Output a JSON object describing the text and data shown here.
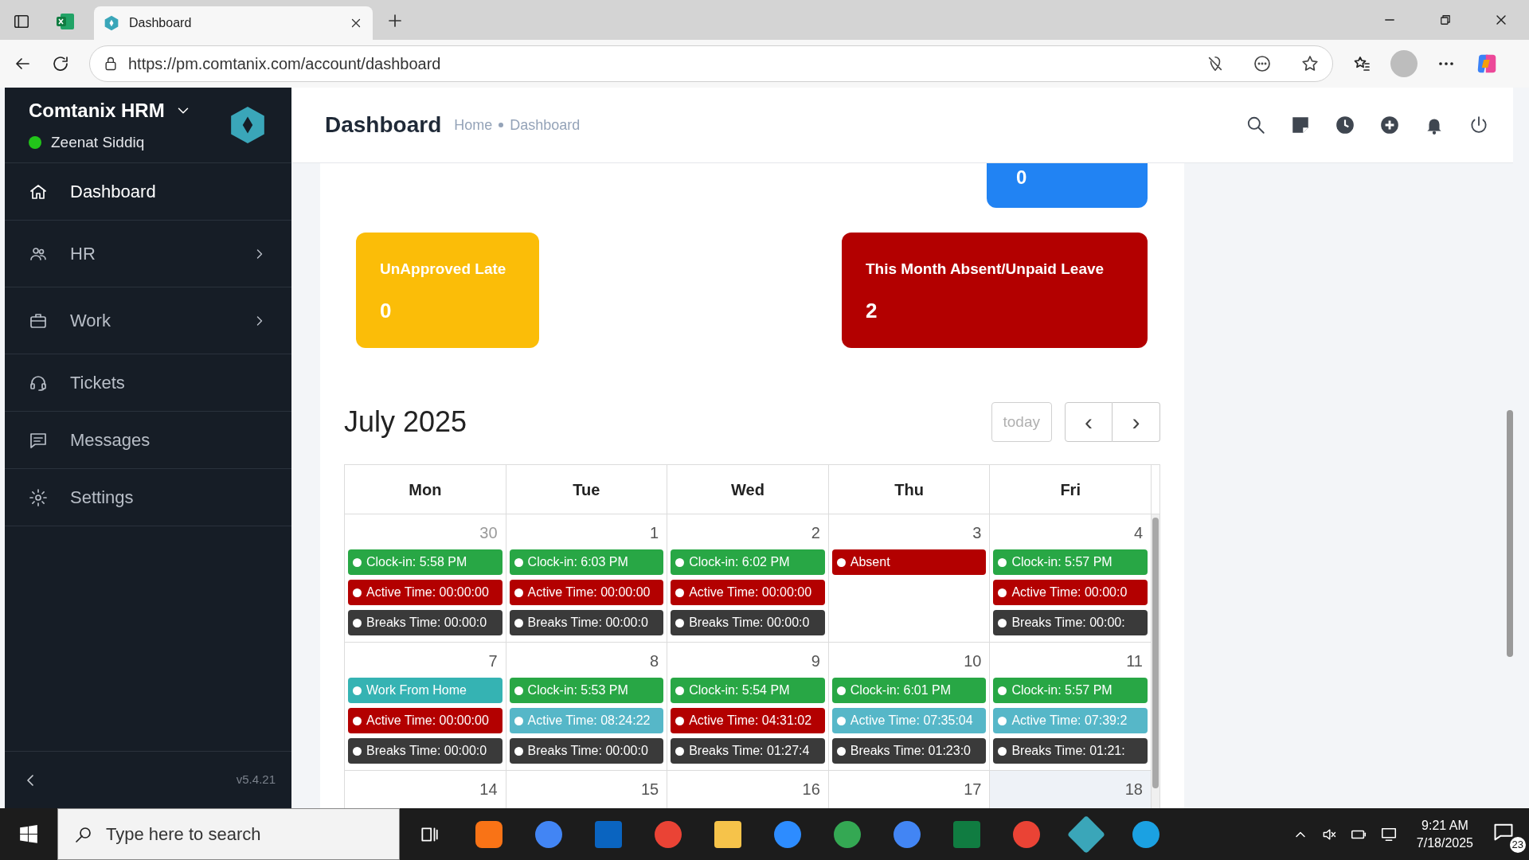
{
  "browser": {
    "tabs": [
      {
        "title": "Dashboard",
        "selected": true
      }
    ],
    "url": "https://pm.comtanix.com/account/dashboard"
  },
  "sidebar": {
    "brand": "Comtanix HRM",
    "user": "Zeenat Siddiq",
    "user_online": true,
    "items": [
      {
        "label": "Dashboard",
        "kind": "home",
        "submenu": false,
        "selected": true
      },
      {
        "label": "HR",
        "kind": "users",
        "submenu": true,
        "selected": false
      },
      {
        "label": "Work",
        "kind": "briefcase",
        "submenu": true,
        "selected": false
      },
      {
        "label": "Tickets",
        "kind": "headset",
        "submenu": false,
        "selected": false
      },
      {
        "label": "Messages",
        "kind": "message",
        "submenu": false,
        "selected": false
      },
      {
        "label": "Settings",
        "kind": "gear",
        "submenu": false,
        "selected": false
      }
    ],
    "version": "v5.4.21"
  },
  "header": {
    "title": "Dashboard",
    "breadcrumb": [
      "Home",
      "Dashboard"
    ]
  },
  "stat_cards": [
    {
      "value": "0",
      "color": "#2183f3",
      "kind": "partial"
    },
    {
      "label": "UnApproved Late",
      "value": "0",
      "color": "#fbbd08",
      "kind": "card"
    },
    {
      "label": "This Month Absent/Unpaid Leave",
      "value": "2",
      "color": "#b30000",
      "kind": "card"
    }
  ],
  "calendar": {
    "title": "July 2025",
    "today_button": "today",
    "prev": "‹",
    "next": "›",
    "columns": [
      "Mon",
      "Tue",
      "Wed",
      "Thu",
      "Fri"
    ],
    "weeks": [
      [
        {
          "day": "30",
          "other_month": true,
          "today": false,
          "events": [
            {
              "text": "Clock-in: 5:58 PM",
              "color": "#28a745"
            },
            {
              "text": "Active Time: 00:00:00",
              "color": "#b30000"
            },
            {
              "text": "Breaks Time: 00:00:0",
              "color": "#3a3a3a"
            }
          ]
        },
        {
          "day": "1",
          "other_month": false,
          "today": false,
          "events": [
            {
              "text": "Clock-in: 6:03 PM",
              "color": "#28a745"
            },
            {
              "text": "Active Time: 00:00:00",
              "color": "#b30000"
            },
            {
              "text": "Breaks Time: 00:00:0",
              "color": "#3a3a3a"
            }
          ]
        },
        {
          "day": "2",
          "other_month": false,
          "today": false,
          "events": [
            {
              "text": "Clock-in: 6:02 PM",
              "color": "#28a745"
            },
            {
              "text": "Active Time: 00:00:00",
              "color": "#b30000"
            },
            {
              "text": "Breaks Time: 00:00:0",
              "color": "#3a3a3a"
            }
          ]
        },
        {
          "day": "3",
          "other_month": false,
          "today": false,
          "events": [
            {
              "text": "Absent",
              "color": "#b30000"
            }
          ]
        },
        {
          "day": "4",
          "other_month": false,
          "today": false,
          "events": [
            {
              "text": "Clock-in: 5:57 PM",
              "color": "#28a745"
            },
            {
              "text": "Active Time: 00:00:0",
              "color": "#b30000"
            },
            {
              "text": "Breaks Time: 00:00:",
              "color": "#3a3a3a"
            }
          ]
        }
      ],
      [
        {
          "day": "7",
          "other_month": false,
          "today": false,
          "events": [
            {
              "text": "Work From Home",
              "color": "#35b3b3"
            },
            {
              "text": "Active Time: 00:00:00",
              "color": "#b30000"
            },
            {
              "text": "Breaks Time: 00:00:0",
              "color": "#3a3a3a"
            }
          ]
        },
        {
          "day": "8",
          "other_month": false,
          "today": false,
          "events": [
            {
              "text": "Clock-in: 5:53 PM",
              "color": "#28a745"
            },
            {
              "text": "Active Time: 08:24:22",
              "color": "#56b7c8"
            },
            {
              "text": "Breaks Time: 00:00:0",
              "color": "#3a3a3a"
            }
          ]
        },
        {
          "day": "9",
          "other_month": false,
          "today": false,
          "events": [
            {
              "text": "Clock-in: 5:54 PM",
              "color": "#28a745"
            },
            {
              "text": "Active Time: 04:31:02",
              "color": "#b30000"
            },
            {
              "text": "Breaks Time: 01:27:4",
              "color": "#3a3a3a"
            }
          ]
        },
        {
          "day": "10",
          "other_month": false,
          "today": false,
          "events": [
            {
              "text": "Clock-in: 6:01 PM",
              "color": "#28a745"
            },
            {
              "text": "Active Time: 07:35:04",
              "color": "#56b7c8"
            },
            {
              "text": "Breaks Time: 01:23:0",
              "color": "#3a3a3a"
            }
          ]
        },
        {
          "day": "11",
          "other_month": false,
          "today": false,
          "events": [
            {
              "text": "Clock-in: 5:57 PM",
              "color": "#28a745"
            },
            {
              "text": "Active Time: 07:39:2",
              "color": "#56b7c8"
            },
            {
              "text": "Breaks Time: 01:21:",
              "color": "#3a3a3a"
            }
          ]
        }
      ],
      [
        {
          "day": "14",
          "other_month": false,
          "today": false
        },
        {
          "day": "15",
          "other_month": false,
          "today": false
        },
        {
          "day": "16",
          "other_month": false,
          "today": false
        },
        {
          "day": "17",
          "other_month": false,
          "today": false
        },
        {
          "day": "18",
          "other_month": false,
          "today": true
        }
      ]
    ]
  },
  "taskbar": {
    "search_placeholder": "Type here to search",
    "time": "9:21 AM",
    "date": "7/18/2025",
    "notifications": "23"
  }
}
